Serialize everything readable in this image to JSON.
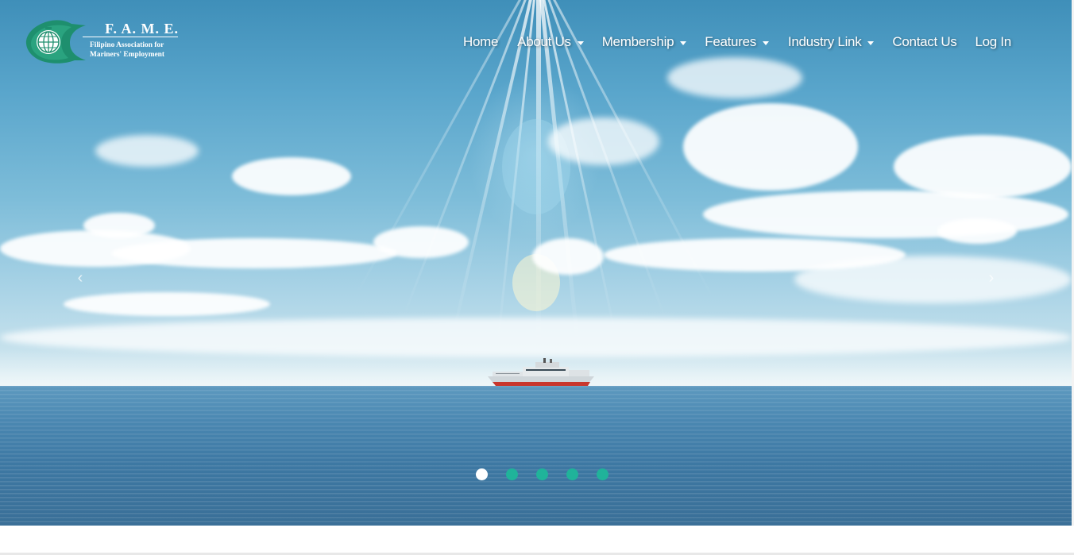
{
  "brand": {
    "title": "F. A. M. E.",
    "subtitle_line1": "Filipino Association for",
    "subtitle_line2": "Mariners' Employment",
    "logo_icon": "globe-crescent-logo",
    "color_green": "#1e8f6e"
  },
  "nav": {
    "items": [
      {
        "label": "Home",
        "dropdown": false
      },
      {
        "label": "About Us",
        "dropdown": true
      },
      {
        "label": "Membership",
        "dropdown": true
      },
      {
        "label": "Features",
        "dropdown": true
      },
      {
        "label": "Industry Link",
        "dropdown": true
      },
      {
        "label": "Contact Us",
        "dropdown": false
      },
      {
        "label": "Log In",
        "dropdown": false
      }
    ]
  },
  "carousel": {
    "prev_icon": "chevron-left-icon",
    "next_icon": "chevron-right-icon",
    "prev_glyph": "‹",
    "next_glyph": "›",
    "slide_count": 5,
    "active_index": 0,
    "dot_active_color": "#ffffff",
    "dot_color": "#20b39a"
  }
}
